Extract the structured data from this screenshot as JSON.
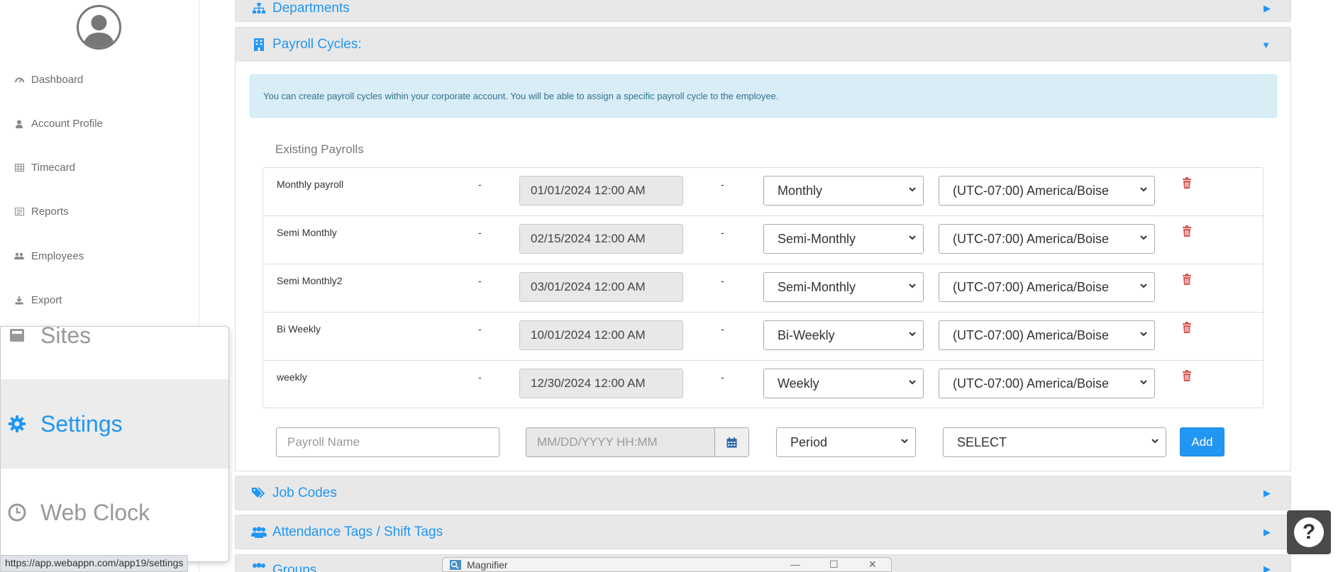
{
  "sidebar": {
    "items": [
      {
        "label": "Dashboard",
        "icon": "dashboard-icon"
      },
      {
        "label": "Account Profile",
        "icon": "user-icon"
      },
      {
        "label": "Timecard",
        "icon": "table-icon"
      },
      {
        "label": "Reports",
        "icon": "report-icon"
      },
      {
        "label": "Employees",
        "icon": "users-icon"
      },
      {
        "label": "Export",
        "icon": "download-icon"
      }
    ]
  },
  "magnified": {
    "items": [
      {
        "label": "Sites"
      },
      {
        "label": "Settings"
      },
      {
        "label": "Web Clock"
      }
    ]
  },
  "status_url": "https://app.webappn.com/app19/settings",
  "panels": {
    "departments": "Departments",
    "payroll_cycles": "Payroll Cycles:",
    "job_codes": "Job Codes",
    "attendance_tags": "Attendance Tags / Shift Tags",
    "groups": "Groups"
  },
  "payroll": {
    "info": "You can create payroll cycles within your corporate account. You will be able to assign a specific payroll cycle to the employee.",
    "existing_title": "Existing Payrolls",
    "dash": "-",
    "rows": [
      {
        "name": "Monthly payroll",
        "date": "01/01/2024 12:00 AM",
        "period": "Monthly",
        "tz": "(UTC-07:00) America/Boise"
      },
      {
        "name": "Semi Monthly",
        "date": "02/15/2024 12:00 AM",
        "period": "Semi-Monthly",
        "tz": "(UTC-07:00) America/Boise"
      },
      {
        "name": "Semi Monthly2",
        "date": "03/01/2024 12:00 AM",
        "period": "Semi-Monthly",
        "tz": "(UTC-07:00) America/Boise"
      },
      {
        "name": "Bi Weekly",
        "date": "10/01/2024 12:00 AM",
        "period": "Bi-Weekly",
        "tz": "(UTC-07:00) America/Boise"
      },
      {
        "name": "weekly",
        "date": "12/30/2024 12:00 AM",
        "period": "Weekly",
        "tz": "(UTC-07:00) America/Boise"
      }
    ],
    "new": {
      "name_placeholder": "Payroll Name",
      "date_placeholder": "MM/DD/YYYY HH:MM",
      "period_value": "Period",
      "tz_value": "SELECT",
      "add_label": "Add"
    }
  },
  "help_label": "?",
  "magnifier_title": "Magnifier",
  "colors": {
    "accent": "#2196f3",
    "info_bg": "#d9edf7",
    "info_text": "#31708f",
    "trash": "#d9534f"
  }
}
